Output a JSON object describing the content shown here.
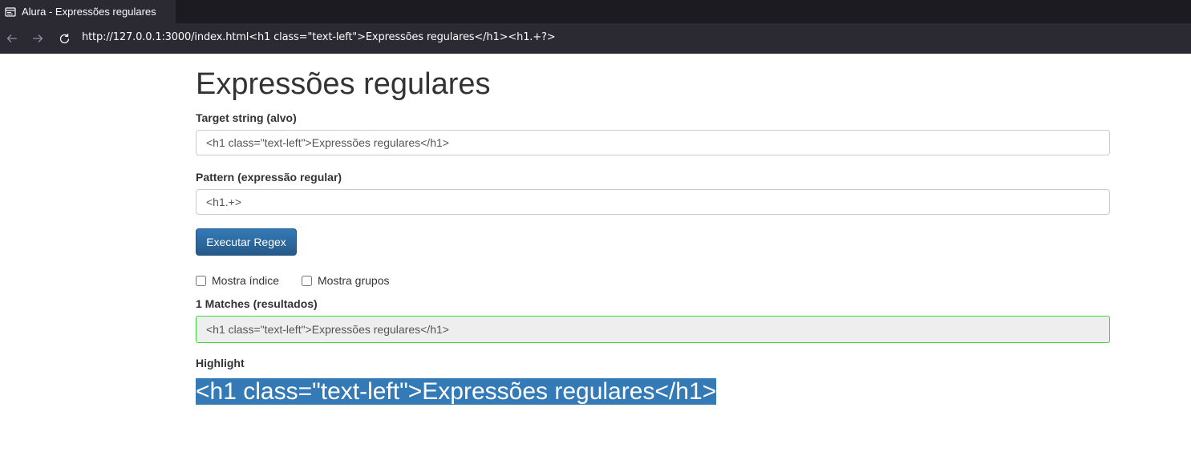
{
  "browser": {
    "tab_title": "Alura - Expressões regulares",
    "url": "http://127.0.0.1:3000/index.html<h1 class=\"text-left\">Expressões regulares</h1><h1.+?>"
  },
  "page": {
    "title": "Expressões regulares",
    "target_label": "Target string (alvo)",
    "target_value": "<h1 class=\"text-left\">Expressões regulares</h1>",
    "pattern_label": "Pattern (expressão regular)",
    "pattern_value": "<h1.+>",
    "run_button": "Executar Regex",
    "checkbox_index": "Mostra índice",
    "checkbox_groups": "Mostra grupos",
    "matches_label": "1 Matches (resultados)",
    "matches_value": "<h1 class=\"text-left\">Expressões regulares</h1>",
    "highlight_label": "Highlight",
    "highlight_value": "<h1 class=\"text-left\">Expressões regulares</h1>"
  },
  "colors": {
    "button": "#337ab7",
    "match_border": "#3fd93f",
    "highlight": "#337ab7"
  }
}
